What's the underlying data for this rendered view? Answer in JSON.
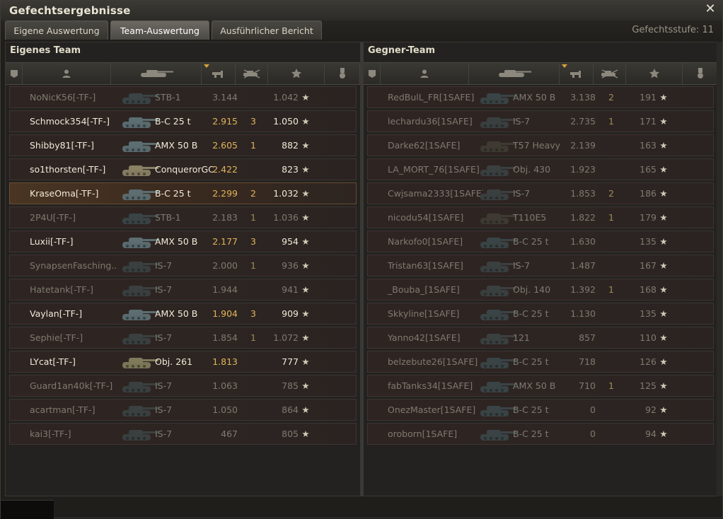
{
  "window": {
    "title": "Gefechtsergebnisse",
    "close_label": "✕"
  },
  "tabs": [
    {
      "label": "Eigene Auswertung",
      "active": false
    },
    {
      "label": "Team-Auswertung",
      "active": true
    },
    {
      "label": "Ausführlicher Bericht",
      "active": false
    }
  ],
  "battle_tier": "Gefechtsstufe: 11",
  "teams": {
    "own": {
      "title": "Eigenes Team",
      "players": [
        {
          "name": "NoNicK56[-TF-]",
          "vehicle": "STB-1",
          "damage": "3.144",
          "kills": "",
          "xp": "1.042",
          "alive": false,
          "tank_color": "#3a4447"
        },
        {
          "name": "Schmock354[-TF-]",
          "vehicle": "B-C 25 t",
          "damage": "2.915",
          "kills": "3",
          "xp": "1.050",
          "alive": true,
          "tank_color": "#5c6e72"
        },
        {
          "name": "Shibby81[-TF-]",
          "vehicle": "AMX 50 B",
          "damage": "2.605",
          "kills": "1",
          "xp": "882",
          "alive": true,
          "tank_color": "#5c6e72"
        },
        {
          "name": "so1thorsten[-TF-]",
          "vehicle": "ConquerorGC",
          "damage": "2.422",
          "kills": "",
          "xp": "823",
          "alive": true,
          "tank_color": "#8a8064"
        },
        {
          "name": "KraseOma[-TF-]",
          "vehicle": "B-C 25 t",
          "damage": "2.299",
          "kills": "2",
          "xp": "1.032",
          "alive": true,
          "tank_color": "#5c6e72",
          "me": true
        },
        {
          "name": "2P4U[-TF-]",
          "vehicle": "STB-1",
          "damage": "2.183",
          "kills": "1",
          "xp": "1.036",
          "alive": false,
          "tank_color": "#3a4447"
        },
        {
          "name": "Luxii[-TF-]",
          "vehicle": "AMX 50 B",
          "damage": "2.177",
          "kills": "3",
          "xp": "954",
          "alive": true,
          "tank_color": "#5c6e72"
        },
        {
          "name": "SynapsenFasching..",
          "vehicle": "IS-7",
          "damage": "2.000",
          "kills": "1",
          "xp": "936",
          "alive": false,
          "tank_color": "#3a4040"
        },
        {
          "name": "Hatetank[-TF-]",
          "vehicle": "IS-7",
          "damage": "1.944",
          "kills": "",
          "xp": "941",
          "alive": false,
          "tank_color": "#3a4040"
        },
        {
          "name": "Vaylan[-TF-]",
          "vehicle": "AMX 50 B",
          "damage": "1.904",
          "kills": "3",
          "xp": "909",
          "alive": true,
          "tank_color": "#5c6e72"
        },
        {
          "name": "Sephie[-TF-]",
          "vehicle": "IS-7",
          "damage": "1.854",
          "kills": "1",
          "xp": "1.072",
          "alive": false,
          "tank_color": "#3a4040"
        },
        {
          "name": "LYcat[-TF-]",
          "vehicle": "Obj. 261",
          "damage": "1.813",
          "kills": "",
          "xp": "777",
          "alive": true,
          "tank_color": "#7e7a5a"
        },
        {
          "name": "Guard1an40k[-TF-]",
          "vehicle": "IS-7",
          "damage": "1.063",
          "kills": "",
          "xp": "785",
          "alive": false,
          "tank_color": "#3a4040"
        },
        {
          "name": "acartman[-TF-]",
          "vehicle": "IS-7",
          "damage": "1.050",
          "kills": "",
          "xp": "864",
          "alive": false,
          "tank_color": "#3a4040"
        },
        {
          "name": "kai3[-TF-]",
          "vehicle": "IS-7",
          "damage": "467",
          "kills": "",
          "xp": "805",
          "alive": false,
          "tank_color": "#3a4040"
        }
      ]
    },
    "enemy": {
      "title": "Gegner-Team",
      "players": [
        {
          "name": "RedBulL_FR[1SAFE]",
          "vehicle": "AMX 50 B",
          "damage": "3.138",
          "kills": "2",
          "xp": "191",
          "alive": false,
          "tank_color": "#3a4447"
        },
        {
          "name": "lechardu36[1SAFE]",
          "vehicle": "IS-7",
          "damage": "2.735",
          "kills": "1",
          "xp": "171",
          "alive": false,
          "tank_color": "#3a4040"
        },
        {
          "name": "Darke62[1SAFE]",
          "vehicle": "T57 Heavy",
          "damage": "2.139",
          "kills": "",
          "xp": "163",
          "alive": false,
          "tank_color": "#3e3a32"
        },
        {
          "name": "LA_MORT_76[1SAFE]",
          "vehicle": "Obj. 430",
          "damage": "1.923",
          "kills": "",
          "xp": "165",
          "alive": false,
          "tank_color": "#3a4040"
        },
        {
          "name": "Cwjsama2333[1SAFE]",
          "vehicle": "IS-7",
          "damage": "1.853",
          "kills": "2",
          "xp": "186",
          "alive": false,
          "tank_color": "#3a4040"
        },
        {
          "name": "nicodu54[1SAFE]",
          "vehicle": "T110E5",
          "damage": "1.822",
          "kills": "1",
          "xp": "179",
          "alive": false,
          "tank_color": "#3e3a32"
        },
        {
          "name": "Narkofo0[1SAFE]",
          "vehicle": "B-C 25 t",
          "damage": "1.630",
          "kills": "",
          "xp": "135",
          "alive": false,
          "tank_color": "#3a4447"
        },
        {
          "name": "Tristan63[1SAFE]",
          "vehicle": "IS-7",
          "damage": "1.487",
          "kills": "",
          "xp": "167",
          "alive": false,
          "tank_color": "#3a4040"
        },
        {
          "name": "_Bouba_[1SAFE]",
          "vehicle": "Obj. 140",
          "damage": "1.392",
          "kills": "1",
          "xp": "168",
          "alive": false,
          "tank_color": "#3a4040"
        },
        {
          "name": "Skkyline[1SAFE]",
          "vehicle": "B-C 25 t",
          "damage": "1.130",
          "kills": "",
          "xp": "135",
          "alive": false,
          "tank_color": "#3a4447"
        },
        {
          "name": "Yanno42[1SAFE]",
          "vehicle": "121",
          "damage": "857",
          "kills": "",
          "xp": "110",
          "alive": false,
          "tank_color": "#3a4040"
        },
        {
          "name": "belzebute26[1SAFE]",
          "vehicle": "B-C 25 t",
          "damage": "718",
          "kills": "",
          "xp": "126",
          "alive": false,
          "tank_color": "#3a4447"
        },
        {
          "name": "fabTanks34[1SAFE]",
          "vehicle": "AMX 50 B",
          "damage": "710",
          "kills": "1",
          "xp": "125",
          "alive": false,
          "tank_color": "#3a4447"
        },
        {
          "name": "OnezMaster[1SAFE]",
          "vehicle": "B-C 25 t",
          "damage": "0",
          "kills": "",
          "xp": "92",
          "alive": false,
          "tank_color": "#3a4447"
        },
        {
          "name": "oroborn[1SAFE]",
          "vehicle": "B-C 25 t",
          "damage": "0",
          "kills": "",
          "xp": "94",
          "alive": false,
          "tank_color": "#3a4447"
        }
      ]
    }
  },
  "columns": [
    {
      "icon": "squad-icon"
    },
    {
      "icon": "player-icon"
    },
    {
      "icon": "tank-icon"
    },
    {
      "icon": "damage-icon",
      "sorted": true
    },
    {
      "icon": "kills-icon"
    },
    {
      "icon": "xp-star-icon"
    },
    {
      "icon": "medal-icon"
    }
  ],
  "xp_star": "★",
  "colors": {
    "accent": "#e1b45a",
    "alive_text": "#f0ead8",
    "dead_text": "#7f7a70",
    "player_highlight": "#4a3523"
  }
}
